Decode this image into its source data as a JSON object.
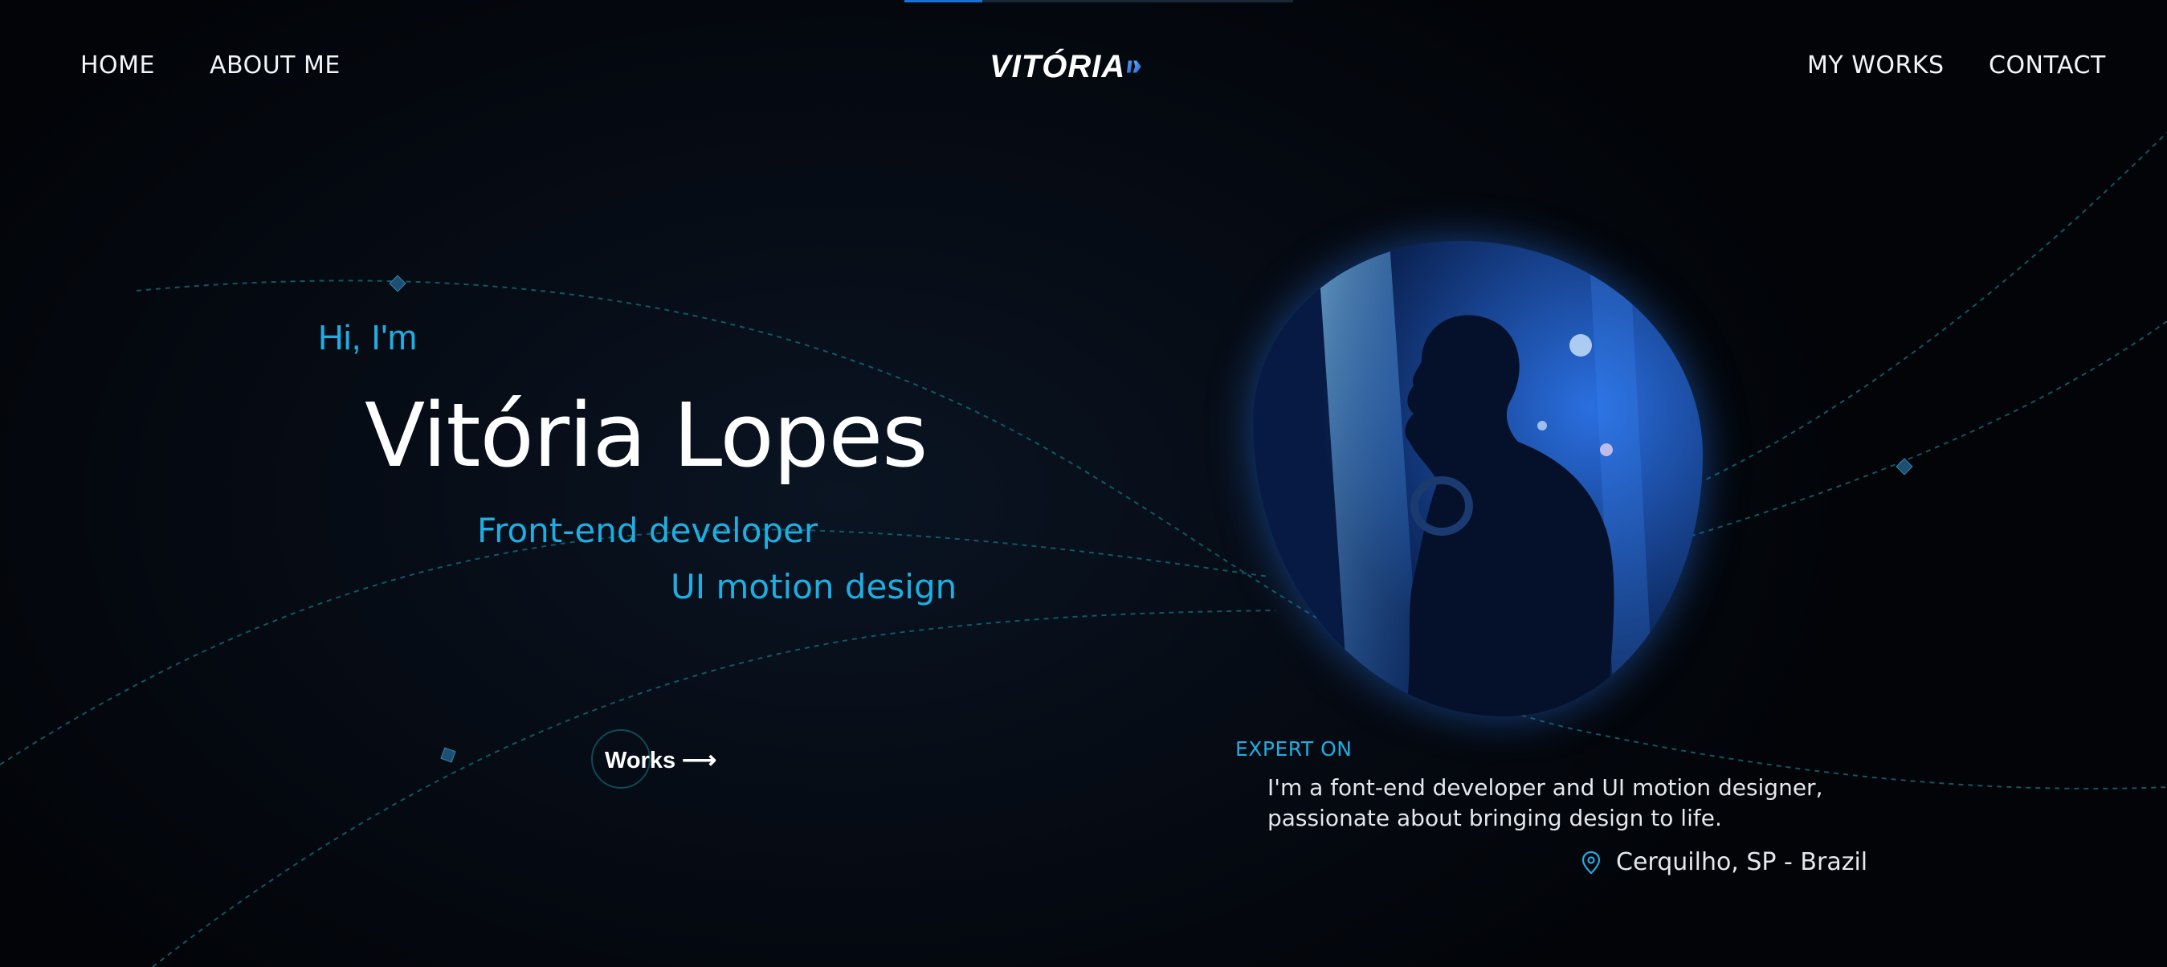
{
  "nav": {
    "home": "HOME",
    "about": "ABOUT ME",
    "works": "MY WORKS",
    "contact": "CONTACT",
    "logo_text": "VITÓRIA"
  },
  "scroll_progress": 0.2,
  "hero": {
    "greeting": "Hi, I'm",
    "name": "Vitória Lopes",
    "role_1": "Front-end developer",
    "role_2": "UI motion design",
    "cta_label": "Works",
    "cta_icon": "arrow-right-icon"
  },
  "about": {
    "heading": "EXPERT ON",
    "bio": "I'm a font-end developer and UI motion designer, passionate about bringing design to life.",
    "location": "Cerquilho, SP - Brazil",
    "location_icon": "map-pin-icon"
  },
  "colors": {
    "accent": "#1eaee2",
    "background": "#020408",
    "glow": "#236edc",
    "progress": "#1b6fd6"
  }
}
